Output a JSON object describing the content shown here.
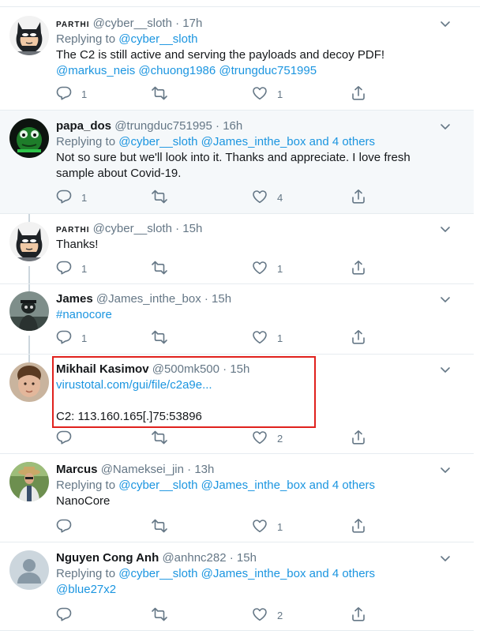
{
  "tweets": [
    {
      "name": "PARTHI",
      "name_caps": true,
      "handle": "@cyber__sloth",
      "time": "17h",
      "lines": [
        [
          {
            "t": "muted",
            "v": "Replying to "
          },
          {
            "t": "link",
            "v": "@cyber__sloth"
          }
        ],
        [
          {
            "t": "text",
            "v": "The C2 is still active and serving the payloads and decoy PDF!"
          }
        ],
        [
          {
            "t": "link",
            "v": "@markus_neis @chuong1986 @trungduc751995"
          }
        ]
      ],
      "reply_count": "1",
      "like_count": "1",
      "retweet_count": "",
      "avatar": "batman"
    },
    {
      "name": "papa_dos",
      "name_caps": false,
      "handle": "@trungduc751995",
      "time": "16h",
      "lines": [
        [
          {
            "t": "muted",
            "v": "Replying to "
          },
          {
            "t": "link",
            "v": "@cyber__sloth @James_inthe_box and 4 others"
          }
        ],
        [
          {
            "t": "text",
            "v": "Not so sure but we'll look into it. Thanks and appreciate. I love fresh"
          }
        ],
        [
          {
            "t": "text",
            "v": "sample about Covid-19."
          }
        ]
      ],
      "reply_count": "1",
      "like_count": "4",
      "retweet_count": "",
      "avatar": "frog"
    },
    {
      "name": "PARTHI",
      "name_caps": true,
      "handle": "@cyber__sloth",
      "time": "15h",
      "lines": [
        [
          {
            "t": "text",
            "v": "Thanks!"
          }
        ]
      ],
      "reply_count": "1",
      "like_count": "1",
      "retweet_count": "",
      "avatar": "batman"
    },
    {
      "name": "James",
      "name_caps": false,
      "handle": "@James_inthe_box",
      "time": "15h",
      "lines": [
        [
          {
            "t": "link",
            "v": "#nanocore"
          }
        ]
      ],
      "reply_count": "1",
      "like_count": "1",
      "retweet_count": "",
      "avatar": "james"
    },
    {
      "name": "Mikhail Kasimov",
      "name_caps": false,
      "handle": "@500mk500",
      "time": "15h",
      "lines": [
        [
          {
            "t": "link",
            "v": "virustotal.com/gui/file/c2a9e..."
          }
        ],
        [
          {
            "t": "text",
            "v": ""
          }
        ],
        [
          {
            "t": "text",
            "v": "C2: 113.160.165[.]75:53896"
          }
        ]
      ],
      "reply_count": "",
      "like_count": "2",
      "retweet_count": "",
      "avatar": "mikhail"
    },
    {
      "name": "Marcus",
      "name_caps": false,
      "handle": "@Nameksei_jin",
      "time": "13h",
      "lines": [
        [
          {
            "t": "muted",
            "v": "Replying to "
          },
          {
            "t": "link",
            "v": "@cyber__sloth @James_inthe_box and 4 others"
          }
        ],
        [
          {
            "t": "text",
            "v": "NanoCore"
          }
        ]
      ],
      "reply_count": "",
      "like_count": "1",
      "retweet_count": "",
      "avatar": "marcus"
    },
    {
      "name": "Nguyen Cong Anh",
      "name_caps": false,
      "handle": "@anhnc282",
      "time": "15h",
      "lines": [
        [
          {
            "t": "muted",
            "v": "Replying to "
          },
          {
            "t": "link",
            "v": "@cyber__sloth @James_inthe_box and 4 others"
          }
        ],
        [
          {
            "t": "link",
            "v": "@blue27x2"
          }
        ]
      ],
      "reply_count": "",
      "like_count": "2",
      "retweet_count": "",
      "avatar": "default"
    }
  ],
  "icons": {
    "reply": "reply-icon",
    "retweet": "retweet-icon",
    "like": "heart-icon",
    "share": "share-icon",
    "more": "chevron-down-icon"
  },
  "colors": {
    "link": "#1b95e0",
    "muted": "#657786",
    "highlight_box": "#e0211d",
    "thread_bg": "#f5f8fa"
  }
}
